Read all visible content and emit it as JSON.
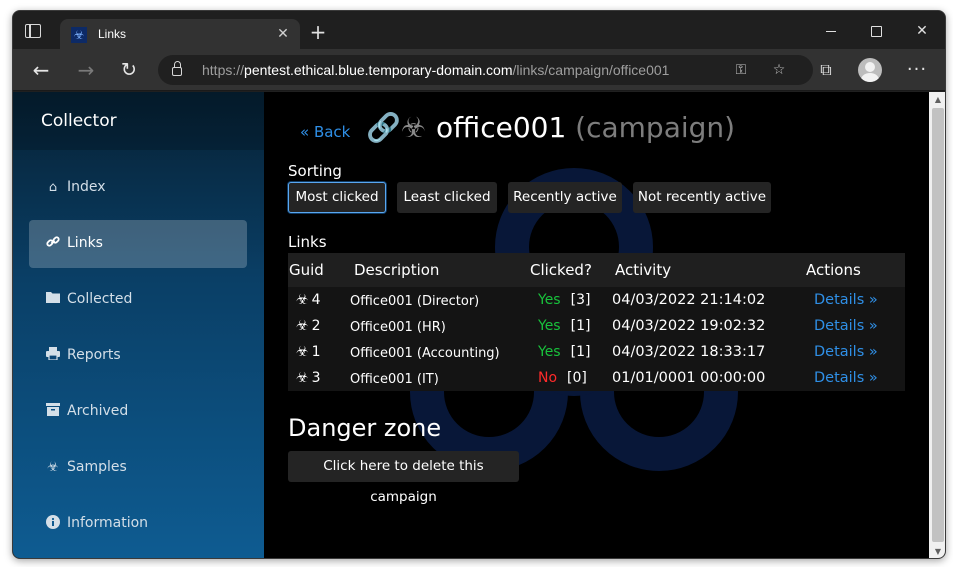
{
  "browser": {
    "tab_title": "Links",
    "tab_close": "✕",
    "new_tab": "+",
    "url_prefix": "https://",
    "url_host": "pentest.ethical.blue.temporary-domain.com",
    "url_path": "/links/campaign/office001"
  },
  "sidebar": {
    "brand": "Collector",
    "items": [
      {
        "label": "Index",
        "icon": "home-icon",
        "glyph": "⌂"
      },
      {
        "label": "Links",
        "icon": "link-icon",
        "glyph": "🔗"
      },
      {
        "label": "Collected",
        "icon": "folder-icon",
        "glyph": "▬"
      },
      {
        "label": "Reports",
        "icon": "print-icon",
        "glyph": "⎙"
      },
      {
        "label": "Archived",
        "icon": "archive-icon",
        "glyph": "▤"
      },
      {
        "label": "Samples",
        "icon": "biohazard-icon",
        "glyph": "☣"
      },
      {
        "label": "Information",
        "icon": "info-icon",
        "glyph": "ℹ"
      }
    ],
    "active_index": 1
  },
  "main": {
    "back_label": "« Back",
    "title_icons": "🔗☣",
    "title": "office001",
    "title_suffix": "(campaign)",
    "sorting_label": "Sorting",
    "sort_buttons": [
      "Most clicked",
      "Least clicked",
      "Recently active",
      "Not recently active"
    ],
    "selected_sort": "Most clicked",
    "links_label": "Links",
    "table": {
      "headers": [
        "Guid",
        "Description",
        "Clicked?",
        "Activity",
        "Actions"
      ],
      "rows": [
        {
          "guid_icon": "☣",
          "guid": "4",
          "description": "Office001 (Director)",
          "clicked": "Yes",
          "count": "[3]",
          "activity": "04/03/2022 21:14:02",
          "action": "Details »"
        },
        {
          "guid_icon": "☣",
          "guid": "2",
          "description": "Office001 (HR)",
          "clicked": "Yes",
          "count": "[1]",
          "activity": "04/03/2022 19:02:32",
          "action": "Details »"
        },
        {
          "guid_icon": "☣",
          "guid": "1",
          "description": "Office001 (Accounting)",
          "clicked": "Yes",
          "count": "[1]",
          "activity": "04/03/2022 18:33:17",
          "action": "Details »"
        },
        {
          "guid_icon": "☣",
          "guid": "3",
          "description": "Office001 (IT)",
          "clicked": "No",
          "count": "[0]",
          "activity": "01/01/0001 00:00:00",
          "action": "Details »"
        }
      ]
    },
    "danger_title": "Danger zone",
    "delete_label": "Click here to delete this campaign"
  },
  "colors": {
    "accent_link": "#2f8fe6",
    "yes": "#18c23c",
    "no": "#ff2a2a",
    "sidebar_top": "#062033",
    "sidebar_bottom": "#0e5c92"
  }
}
